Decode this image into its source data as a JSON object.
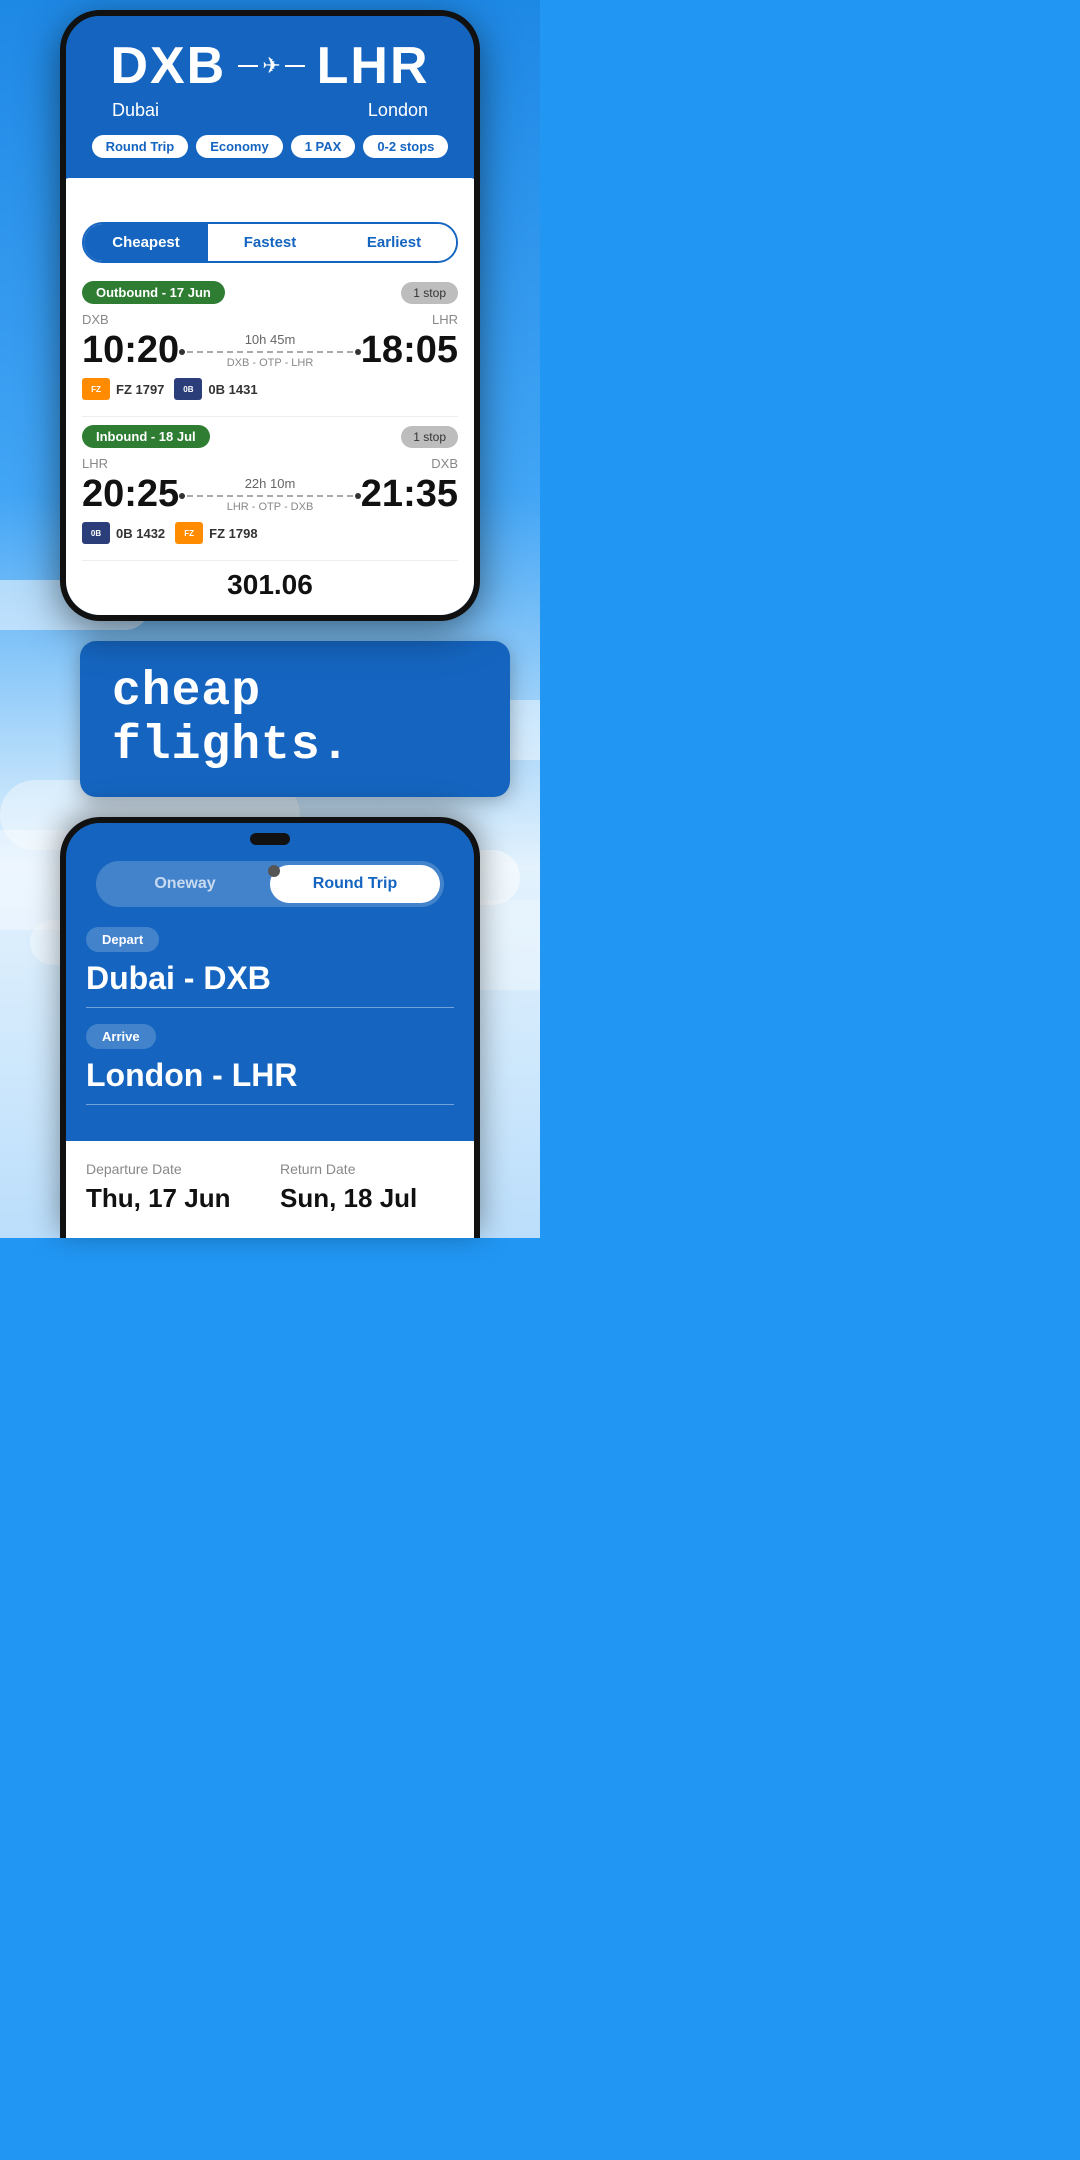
{
  "phone1": {
    "origin_code": "DXB",
    "origin_city": "Dubai",
    "destination_code": "LHR",
    "destination_city": "London",
    "tags": {
      "trip_type": "Round Trip",
      "cabin": "Economy",
      "pax": "1 PAX",
      "stops": "0-2 stops"
    },
    "filters": {
      "cheapest": "Cheapest",
      "fastest": "Fastest",
      "earliest": "Earliest",
      "active": "Cheapest"
    },
    "outbound": {
      "label": "Outbound - 17 Jun",
      "stop_badge": "1 stop",
      "from": "DXB",
      "to": "LHR",
      "depart_time": "10:20",
      "arrive_time": "18:05",
      "duration": "10h 45m",
      "route": "DXB - OTP - LHR",
      "airlines": [
        {
          "code": "FZ 1797",
          "type": "flydubai"
        },
        {
          "code": "0B 1431",
          "type": "tarom"
        }
      ]
    },
    "inbound": {
      "label": "Inbound - 18 Jul",
      "stop_badge": "1 stop",
      "from": "LHR",
      "to": "DXB",
      "depart_time": "20:25",
      "arrive_time": "21:35",
      "duration": "22h 10m",
      "route": "LHR - OTP - DXB",
      "airlines": [
        {
          "code": "0B 1432",
          "type": "tarom"
        },
        {
          "code": "FZ 1798",
          "type": "flydubai"
        }
      ]
    },
    "price_preview": "301.06"
  },
  "middle": {
    "tagline": "cheap flights."
  },
  "phone2": {
    "trip_options": {
      "oneway": "Oneway",
      "round_trip": "Round Trip",
      "active": "Round Trip"
    },
    "depart_label": "Depart",
    "depart_value": "Dubai - DXB",
    "arrive_label": "Arrive",
    "arrive_value": "London - LHR",
    "departure_date_label": "Departure Date",
    "departure_date_value": "Thu, 17 Jun",
    "return_date_label": "Return Date",
    "return_date_value": "Sun, 18 Jul"
  }
}
